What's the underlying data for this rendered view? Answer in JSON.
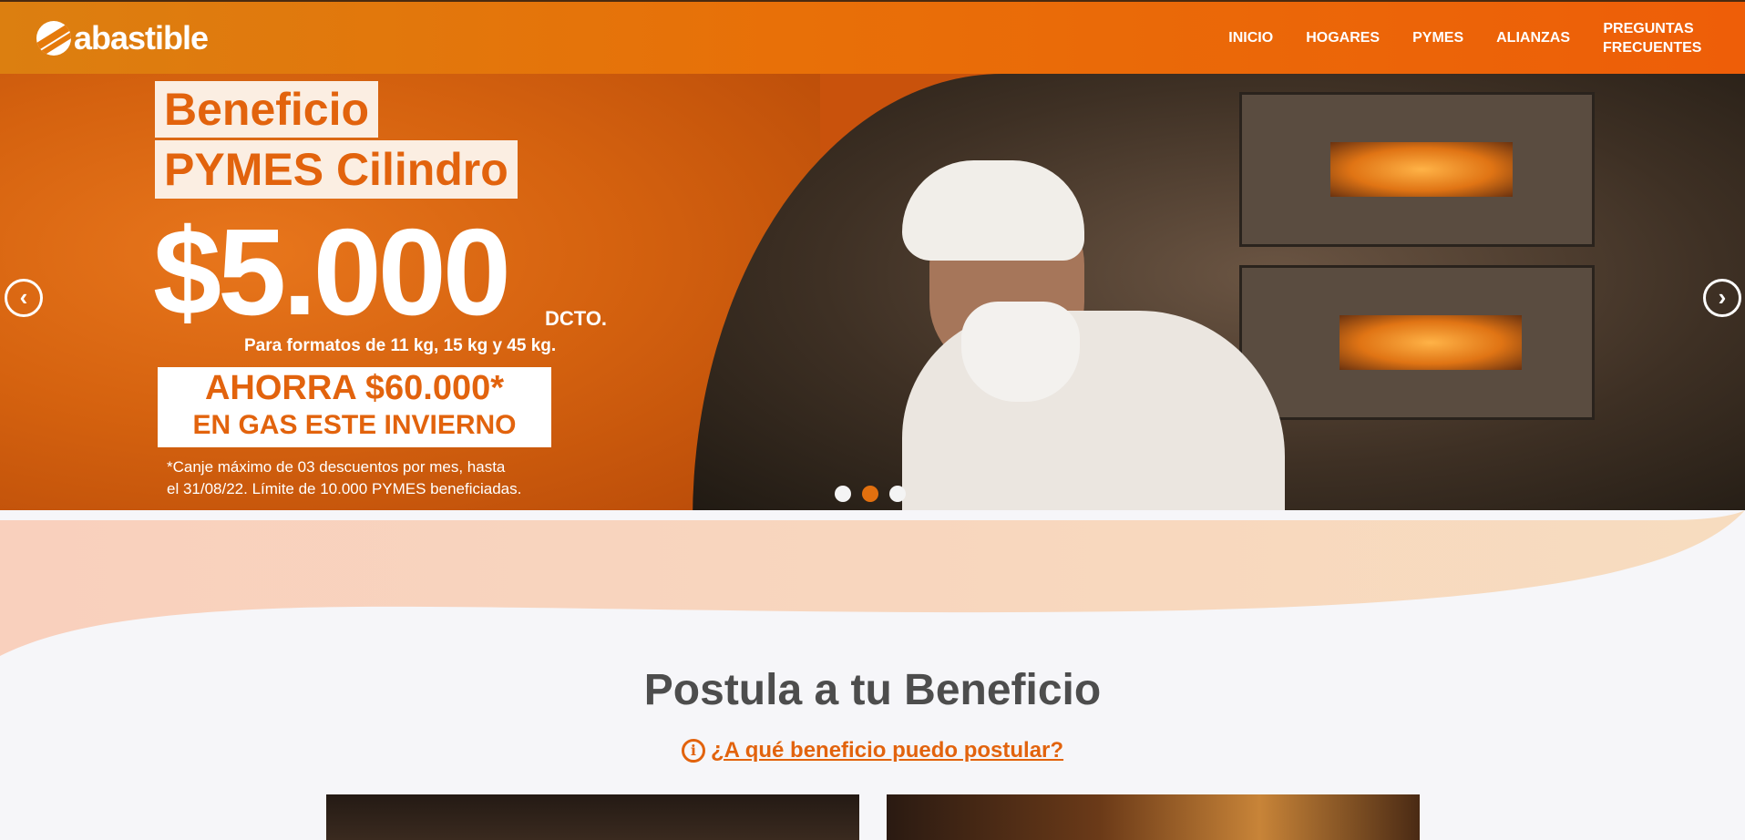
{
  "header": {
    "logo_text": "abastible",
    "nav": [
      {
        "label": "INICIO"
      },
      {
        "label": "HOGARES"
      },
      {
        "label": "PYMES"
      },
      {
        "label": "ALIANZAS"
      }
    ],
    "faq_line1": "PREGUNTAS",
    "faq_line2": "FRECUENTES"
  },
  "hero": {
    "title_line1": "Beneficio",
    "title_line2": "PYMES Cilindro",
    "price": "$5.000",
    "price_suffix": "DCTO.",
    "formats": "Para formatos de 11 kg, 15 kg y 45 kg.",
    "savings_line1": "AHORRA $60.000*",
    "savings_line2": "EN GAS ESTE INVIERNO",
    "disclaimer_line1": "*Canje máximo de 03 descuentos por mes, hasta",
    "disclaimer_line2": "el 31/08/22. Límite de 10.000 PYMES beneficiadas.",
    "prev_icon": "chevron-left-icon",
    "next_icon": "chevron-right-icon",
    "slide_count": 3,
    "active_slide": 2
  },
  "section": {
    "title": "Postula a tu Beneficio",
    "help_icon": "info-icon",
    "help_link": "¿A qué beneficio puedo postular?"
  },
  "colors": {
    "brand_orange": "#e2630d",
    "header_start": "#dc7f10",
    "header_end": "#ee5e08",
    "wave_peach": "#f8d6bf",
    "page_bg": "#f6f6f9",
    "title_gray": "#4d4d4d"
  }
}
